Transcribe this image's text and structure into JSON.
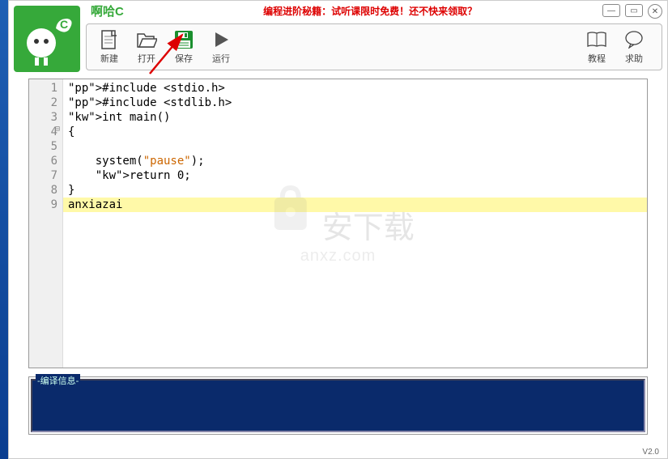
{
  "app": {
    "title": "啊哈C",
    "version": "V2.0"
  },
  "promo": "编程进阶秘籍：试听课限时免费！还不快来领取？",
  "toolbar": {
    "new": "新建",
    "open": "打开",
    "save": "保存",
    "run": "运行",
    "tutorial": "教程",
    "help": "求助"
  },
  "code": {
    "lines": [
      {
        "n": 1,
        "raw": "#include <stdio.h>"
      },
      {
        "n": 2,
        "raw": "#include <stdlib.h>"
      },
      {
        "n": 3,
        "raw": "int main()"
      },
      {
        "n": 4,
        "raw": "{"
      },
      {
        "n": 5,
        "raw": ""
      },
      {
        "n": 6,
        "raw": "    system(\"pause\");"
      },
      {
        "n": 7,
        "raw": "    return 0;"
      },
      {
        "n": 8,
        "raw": "}"
      },
      {
        "n": 9,
        "raw": "anxiazai",
        "highlight": true
      }
    ]
  },
  "console": {
    "legend": "-编译信息-"
  },
  "watermark": {
    "text": "安下载",
    "sub": "anxz.com"
  }
}
